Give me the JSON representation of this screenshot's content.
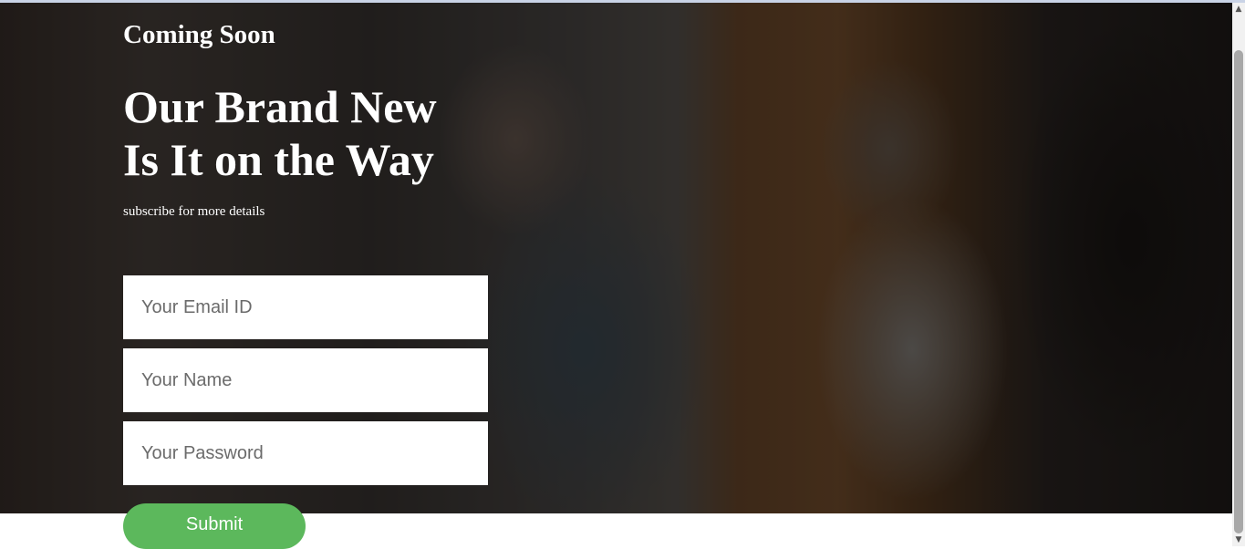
{
  "hero": {
    "eyebrow": "Coming Soon",
    "headline_line1": "Our Brand New",
    "headline_line2": "Is It on the Way",
    "subtitle": "subscribe for more details",
    "background_image": "people-smiling-photo"
  },
  "form": {
    "email_placeholder": "Your Email ID",
    "name_placeholder": "Your Name",
    "password_placeholder": "Your Password",
    "submit_label": "Submit"
  },
  "scrollbar": {
    "up_icon": "triangle-up-icon",
    "down_icon": "triangle-down-icon"
  },
  "colors": {
    "submit_bg": "#5cb85c",
    "text": "#ffffff",
    "overlay": "rgba(0,0,0,0.45)"
  }
}
